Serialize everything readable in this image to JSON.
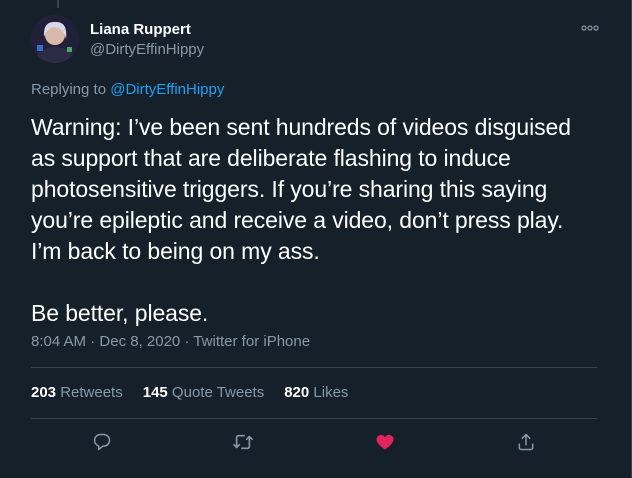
{
  "tweet": {
    "author": {
      "display_name": "Liana Ruppert",
      "handle": "@DirtyEffinHippy"
    },
    "replying_to_prefix": "Replying to ",
    "replying_to_handle": "@DirtyEffinHippy",
    "text_lines": [
      "Warning: I’ve been sent hundreds of videos disguised",
      "as support that are deliberate flashing to induce",
      "photosensitive triggers. If you’re sharing this saying",
      "you’re epileptic and receive a video, don’t press play.",
      "I’m back to being on my ass.",
      "Be better, please."
    ],
    "time": "8:04 AM",
    "date": "Dec 8, 2020",
    "source": "Twitter for iPhone",
    "separator": " · ",
    "stats": {
      "retweets_count": "203",
      "retweets_label": " Retweets",
      "quote_count": "145",
      "quote_label": " Quote Tweets",
      "likes_count": "820",
      "likes_label": " Likes"
    }
  },
  "icons": {
    "more": "more-icon",
    "reply": "reply-icon",
    "retweet": "retweet-icon",
    "like": "heart-icon",
    "share": "share-icon"
  },
  "colors": {
    "background": "#15202b",
    "link": "#1da1f2",
    "secondary_text": "#8899a6",
    "border": "#38444d",
    "like_active": "#e0245e"
  }
}
